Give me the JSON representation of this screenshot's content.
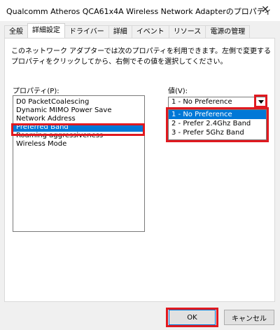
{
  "window": {
    "title": "Qualcomm Atheros QCA61x4A Wireless Network Adapterのプロパティ",
    "close_glyph": "✕"
  },
  "tabs": [
    {
      "label": "全般",
      "active": false
    },
    {
      "label": "詳細設定",
      "active": true
    },
    {
      "label": "ドライバー",
      "active": false
    },
    {
      "label": "詳細",
      "active": false
    },
    {
      "label": "イベント",
      "active": false
    },
    {
      "label": "リソース",
      "active": false
    },
    {
      "label": "電源の管理",
      "active": false
    }
  ],
  "description": "このネットワーク アダプターでは次のプロパティを利用できます。左側で変更するプロパティをクリックしてから、右側でその値を選択してください。",
  "property_label": "プロパティ(P):",
  "value_label": "値(V):",
  "properties": [
    "D0 PacketCoalescing",
    "Dynamic MIMO Power Save",
    "Network Address",
    "Preferred Band",
    "Roaming aggressiveness",
    "Wireless Mode"
  ],
  "selected_property": "Preferred Band",
  "value": {
    "current": "1 - No Preference",
    "options": [
      "1 - No Preference",
      "2 - Prefer 2.4Ghz Band",
      "3 - Prefer 5Ghz Band"
    ]
  },
  "buttons": {
    "ok": "OK",
    "cancel": "キャンセル"
  },
  "colors": {
    "selection": "#0078d7",
    "highlight_box": "#e0191f"
  }
}
